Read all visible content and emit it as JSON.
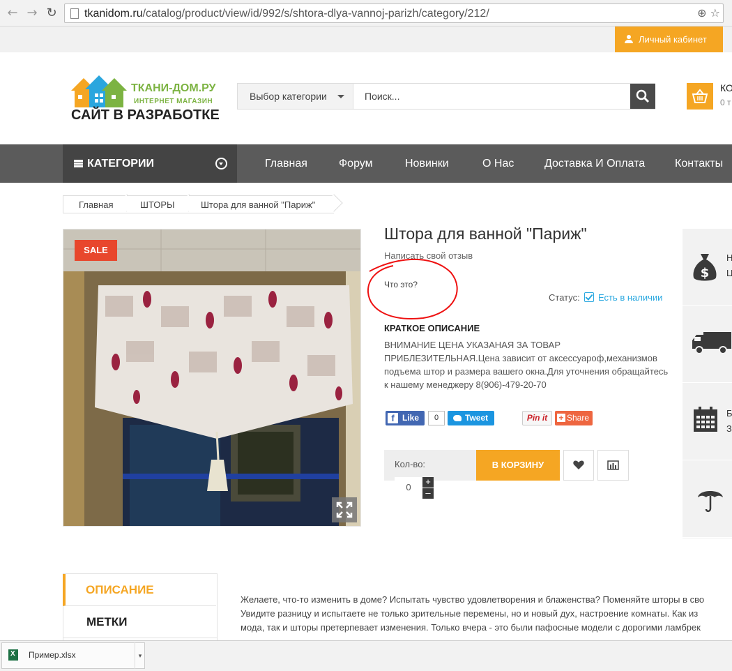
{
  "browser": {
    "back_icon": "back-arrow-icon",
    "forward_icon": "forward-arrow-icon",
    "reload_icon": "reload-icon",
    "url_host": "tkanidom.ru",
    "url_path": "/catalog/product/view/id/992/s/shtora-dlya-vannoj-parizh/category/212/"
  },
  "topbar": {
    "account_label": "Личный кабинет"
  },
  "header": {
    "logo_brand": "ТКАНИ-ДОМ.РУ",
    "logo_sub": "ИНТЕРНЕТ МАГАЗИН",
    "logo_dev": "САЙТ В РАЗРАБОТКЕ",
    "category_select": "Выбор категории",
    "search_placeholder": "Поиск...",
    "cart_title": "КО",
    "cart_sub": "0 т"
  },
  "nav": {
    "categories_label": "КАТЕГОРИИ",
    "items": [
      "Главная",
      "Форум",
      "Новинки",
      "О Нас",
      "Доставка И Оплата",
      "Контакты"
    ]
  },
  "breadcrumb": [
    "Главная",
    "ШТОРЫ",
    "Штора для ванной \"Париж\""
  ],
  "product": {
    "sale_badge": "SALE",
    "title": "Штора для ванной \"Париж\"",
    "review_link": "Написать свой отзыв",
    "annotation_text": "Что это?",
    "status_label": "Статус:",
    "status_value": "Есть в наличии",
    "short_desc_title": "КРАТКОЕ ОПИСАНИЕ",
    "short_desc_text": "ВНИМАНИЕ ЦЕНА УКАЗАНАЯ ЗА ТОВАР ПРИБЛЕЗИТЕЛЬНАЯ.Цена зависит от аксессуароф,механизмов подъема штор и размера вашего окна.Для уточнения обращайтесь к нашему менеджеру 8(906)-479-20-70",
    "qty_label": "Кол-во:",
    "qty_value": "0",
    "add_to_cart": "В КОРЗИНУ"
  },
  "social": {
    "fb_like": "Like",
    "fb_count": "0",
    "tweet": "Tweet",
    "pin": "Pin it",
    "share": "Share"
  },
  "features": [
    {
      "icon": "money-bag-icon",
      "text_line1": "Н",
      "text_line2": "Ц"
    },
    {
      "icon": "delivery-truck-icon",
      "text_line1": "",
      "text_line2": ""
    },
    {
      "icon": "calendar-icon",
      "text_line1": "Б",
      "text_line2": "З"
    },
    {
      "icon": "umbrella-icon",
      "text_line1": "",
      "text_line2": ""
    }
  ],
  "tabs": {
    "description": "ОПИСАНИЕ",
    "tags": "МЕТКИ"
  },
  "description_lines": [
    "Желаете, что-то изменить в доме? Испытать чувство удовлетворения и блаженства? Поменяйте шторы в сво",
    "Увидите разницу и испытаете не только зрительные перемены, но и новый дух, настроение комнаты. Как из",
    "мода, так и шторы претерпевает изменения. Только вчера - это были пафосные модели с дорогими ламбрек"
  ],
  "download": {
    "file_name": "Пример.xlsx"
  },
  "colors": {
    "accent": "#f5a623",
    "nav_bg": "#5b5b5b",
    "sale": "#e8472d",
    "link": "#29a8e0"
  }
}
